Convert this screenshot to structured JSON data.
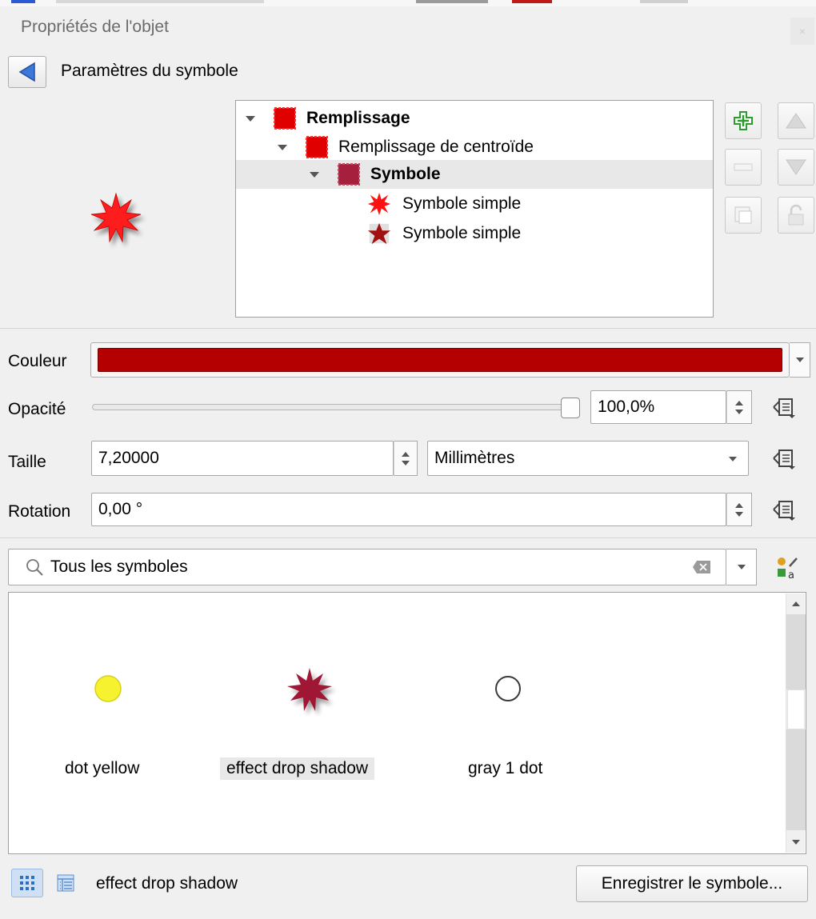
{
  "window": {
    "title": "Propriétés de l'objet",
    "close": "×"
  },
  "header": {
    "title": "Paramètres du symbole"
  },
  "tree": {
    "items": [
      {
        "label": "Remplissage",
        "bold": true,
        "color": "#e00000"
      },
      {
        "label": "Remplissage de centroïde",
        "bold": false,
        "color": "#e00000"
      },
      {
        "label": "Symbole",
        "bold": true,
        "color": "#a61f3c"
      },
      {
        "label": "Symbole simple",
        "bold": false,
        "color": "#ff0000"
      },
      {
        "label": "Symbole simple",
        "bold": false,
        "color": "#a10f12"
      }
    ]
  },
  "form": {
    "color_label": "Couleur",
    "color_value": "#b40000",
    "opacity_label": "Opacité",
    "opacity_value": "100,0%",
    "opacity_fraction": 1.0,
    "size_label": "Taille",
    "size_value": "7,20000",
    "size_unit": "Millimètres",
    "rotation_label": "Rotation",
    "rotation_value": "0,00 °"
  },
  "search": {
    "value": "Tous les symboles"
  },
  "library": {
    "items": [
      {
        "label": "dot yellow",
        "icon": "yellow-dot-icon"
      },
      {
        "label": "effect drop shadow",
        "icon": "star-burst-icon"
      },
      {
        "label": "gray 1 dot",
        "icon": "gray-circle-icon"
      }
    ]
  },
  "footer": {
    "selected_name": "effect drop shadow",
    "save_label": "Enregistrer le symbole..."
  },
  "colors": {
    "accent_red": "#b40000",
    "star_red": "#ff1a1a",
    "star_dark": "#a01234",
    "add_green": "#2a9d2a"
  }
}
